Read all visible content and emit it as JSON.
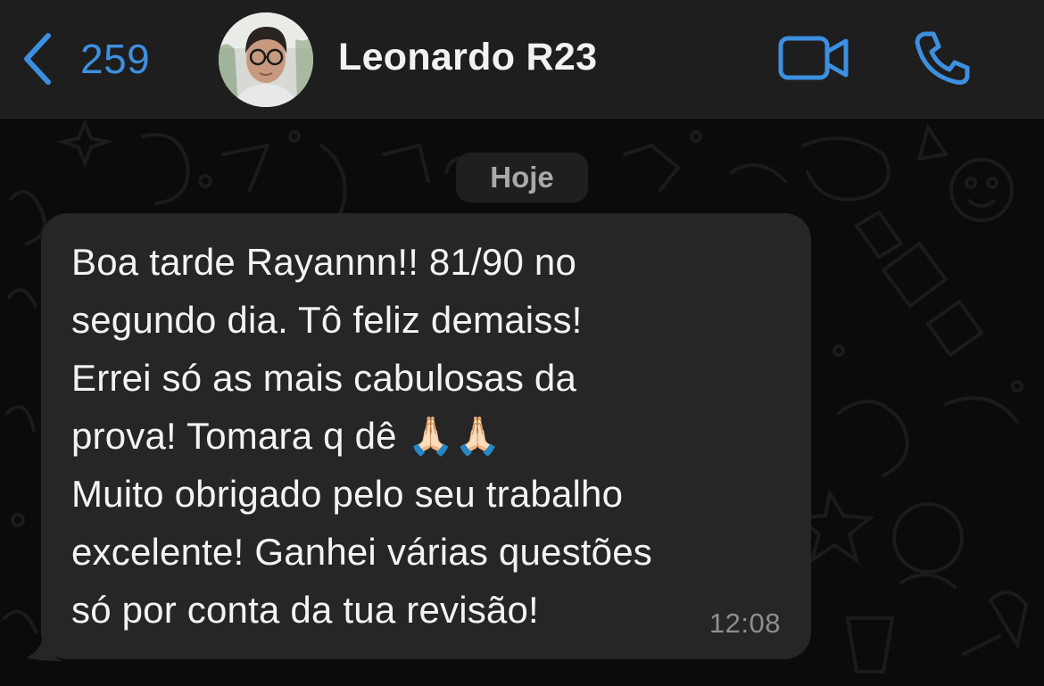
{
  "header": {
    "back_count": "259",
    "contact_name": "Leonardo R23",
    "accent_color": "#3d8fe0"
  },
  "chat": {
    "date_label": "Hoje",
    "messages": [
      {
        "direction": "incoming",
        "text": "Boa tarde Rayannn!! 81/90 no\nsegundo dia. Tô feliz demaiss!\nErrei só as mais cabulosas da\nprova! Tomara q dê 🙏🏻🙏🏻\nMuito obrigado pelo seu trabalho\nexcelente! Ganhei várias questões\nsó por conta da tua revisão!",
        "time": "12:08"
      }
    ]
  },
  "icons": [
    "chevron-left-icon",
    "video-camera-icon",
    "phone-icon"
  ],
  "colors": {
    "header_bg": "#1e1e1e",
    "chat_bg": "#0b0b0b",
    "bubble_bg": "#262626"
  }
}
